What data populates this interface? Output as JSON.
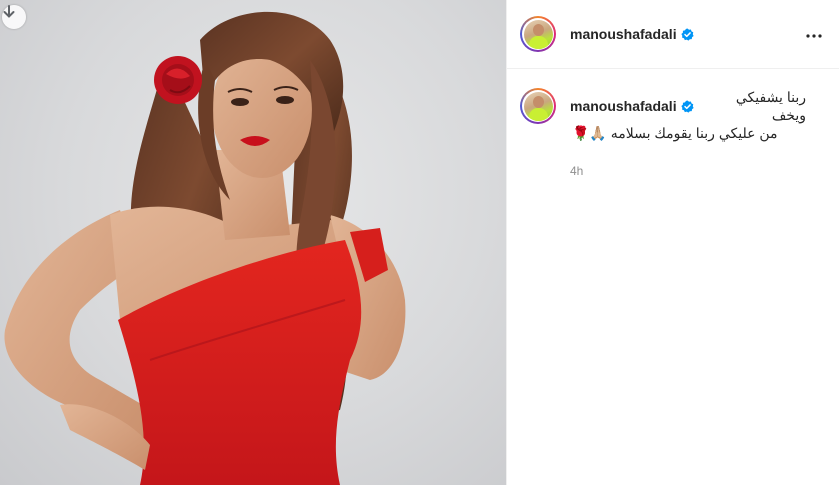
{
  "post": {
    "username": "manoushafadali",
    "caption_line1": "ربنا يشفيكي ويخف",
    "caption_line2": "من عليكي ربنا يقومك بسلامه 🙏🏼🌹",
    "timestamp": "4h"
  },
  "icons": {
    "download": "download-arrow-icon",
    "verified": "verified-badge-icon",
    "more": "more-options-icon"
  },
  "colors": {
    "verified_blue": "#0095f6",
    "dress_red": "#d8201d",
    "text": "#262626",
    "muted": "#8e8e8e",
    "border": "#efefef"
  }
}
